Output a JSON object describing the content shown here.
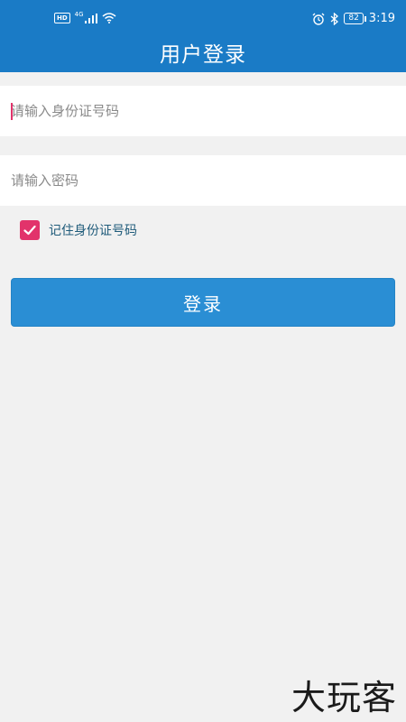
{
  "status_bar": {
    "hd": "HD",
    "network": "4G",
    "battery": "82",
    "time": "3:19"
  },
  "header": {
    "title": "用户登录"
  },
  "form": {
    "id_placeholder": "请输入身份证号码",
    "password_placeholder": "请输入密码",
    "remember_label": "记住身份证号码",
    "remember_checked": true,
    "login_label": "登录"
  },
  "watermark": "大玩客",
  "colors": {
    "primary": "#1a7bc6",
    "button": "#2a8ed4",
    "accent": "#e2336b",
    "background": "#f1f1f1"
  }
}
